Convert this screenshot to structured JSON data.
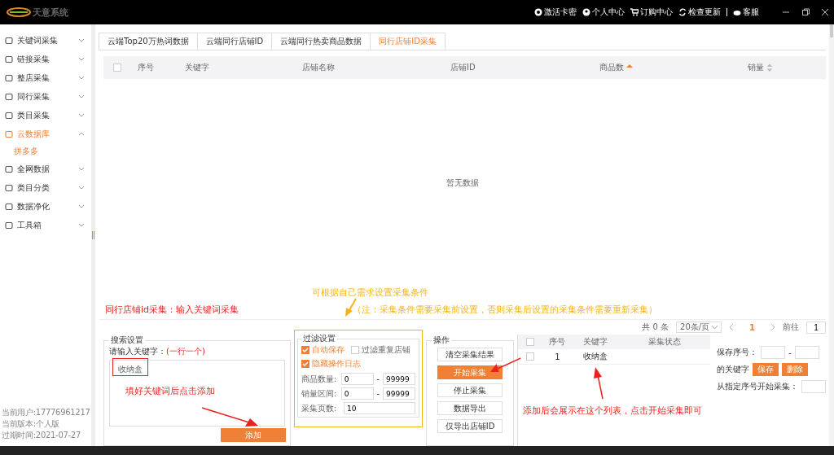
{
  "app": {
    "logo_text": "天意系统"
  },
  "top_nav": [
    {
      "label": "激活卡密"
    },
    {
      "label": "个人中心"
    },
    {
      "label": "订购中心"
    },
    {
      "label": "检查更新"
    },
    {
      "label": "客服"
    }
  ],
  "sidebar": {
    "items": [
      {
        "label": "关键词采集",
        "expanded": false
      },
      {
        "label": "链接采集",
        "expanded": false
      },
      {
        "label": "整店采集",
        "expanded": false
      },
      {
        "label": "同行采集",
        "expanded": false
      },
      {
        "label": "类目采集",
        "expanded": false
      },
      {
        "label": "云数据库",
        "expanded": true,
        "children": [
          {
            "label": "拼多多",
            "selected": true
          }
        ]
      },
      {
        "label": "全网数据",
        "expanded": false
      },
      {
        "label": "类目分类",
        "expanded": false
      },
      {
        "label": "数据净化",
        "expanded": false
      },
      {
        "label": "工具箱",
        "expanded": false
      }
    ],
    "footer": [
      "当前用户:17776961217",
      "当前版本:个人版",
      "过期时间:2021-07-27"
    ]
  },
  "tabs": [
    {
      "label": "云端Top20万热词数据",
      "selected": false
    },
    {
      "label": "云端同行店铺ID",
      "selected": false
    },
    {
      "label": "云端同行热卖商品数据",
      "selected": false
    },
    {
      "label": "同行店铺ID采集",
      "selected": true
    }
  ],
  "table": {
    "all_checked": false,
    "columns": [
      {
        "label": "序号",
        "sortable": false
      },
      {
        "label": "关键字",
        "sortable": false
      },
      {
        "label": "店铺名称",
        "sortable": false
      },
      {
        "label": "店铺ID",
        "sortable": false
      },
      {
        "label": "商品数",
        "sortable": true,
        "sorted": true
      },
      {
        "label": "销量",
        "sortable": true,
        "sorted": false
      }
    ],
    "empty_text": "暂无数据"
  },
  "annotations": [
    {
      "kind": "hint",
      "text": "可根据自己需求设置采集条件"
    },
    {
      "kind": "title",
      "text": "同行店铺id采集：输入关键词采集"
    },
    {
      "kind": "note",
      "text": "（注：采集条件需要采集前设置，否则采集后设置的采集条件需要重新采集）"
    },
    {
      "kind": "callout",
      "text": "填好关键词后点击添加"
    },
    {
      "kind": "callout",
      "text": "添加后会展示在这个列表，点击开始采集即可"
    }
  ],
  "pagination": {
    "total": "共 0 条",
    "page_size": "20条/页",
    "pages": [
      {
        "label": "1",
        "selected": true
      }
    ],
    "goto_label": "前往",
    "goto_value": "1"
  },
  "search_settings": {
    "legend": "搜索设置",
    "prompt": "请输入关键字：",
    "prompt_note": "(一行一个)",
    "value": "收纳盒",
    "add_button": "添加"
  },
  "filter_settings": {
    "legend": "过滤设置",
    "checks": [
      {
        "label": "自动保存",
        "checked": true
      },
      {
        "label": "过滤重复店铺",
        "checked": false
      },
      {
        "label": "隐藏操作日志",
        "checked": true
      }
    ],
    "dash": "-",
    "ranges": [
      {
        "label": "商品数量:",
        "from": "0",
        "to": "99999"
      },
      {
        "label": "销量区间:",
        "from": "0",
        "to": "99999"
      }
    ],
    "pages": {
      "label": "采集页数:",
      "value": "10"
    }
  },
  "operations": {
    "legend": "操作",
    "buttons": [
      {
        "label": "清空采集结果",
        "primary": false
      },
      {
        "label": "开始采集",
        "primary": true
      },
      {
        "label": "停止采集",
        "primary": false
      },
      {
        "label": "数据导出",
        "primary": false
      },
      {
        "label": "仅导出店铺ID",
        "primary": false
      }
    ]
  },
  "keyword_table": {
    "all_checked": false,
    "columns": [
      "序号",
      "关键字",
      "采集状态"
    ],
    "rows": [
      {
        "index": "1",
        "keyword": "收纳盒",
        "checked": false
      }
    ]
  },
  "keyword_tools": {
    "save_index_label": "保存序号：",
    "dash": "-",
    "keyword_label": "的关键字",
    "save_button": "保存",
    "delete_button": "删除",
    "start_label": "从指定序号开始采集："
  }
}
